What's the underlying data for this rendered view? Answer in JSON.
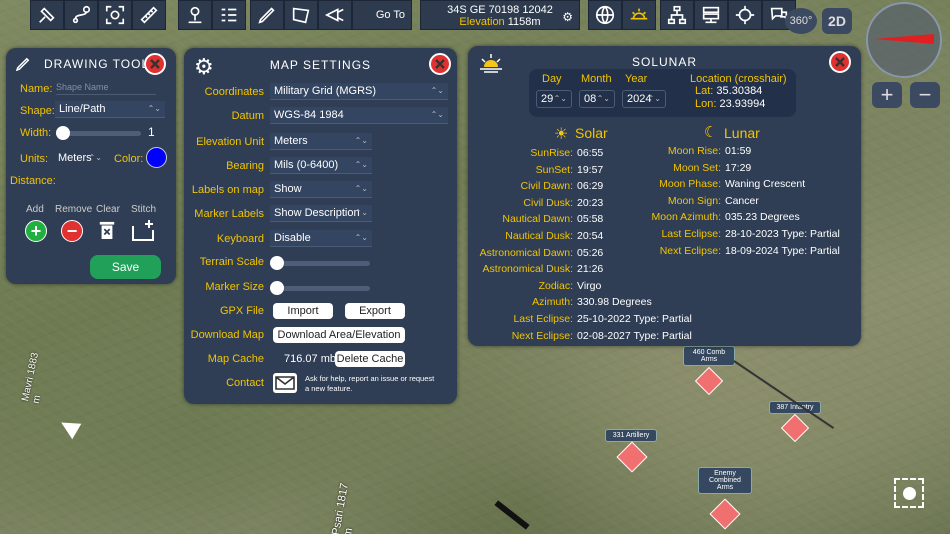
{
  "toolbar": {
    "goto_label": "Go To",
    "coord": "34S GE 70198 12042",
    "elevation_label": "Elevation",
    "elevation_value": "1158m",
    "icons_left": [
      "satellite-icon",
      "route-icon",
      "target-scan-icon",
      "ruler-icon"
    ],
    "icons_mid": [
      "pin-user-icon",
      "list-icon",
      "pencil-icon",
      "polygon-icon",
      "projector-icon"
    ],
    "icons_right": [
      "globe-icon",
      "sunset-icon",
      "network-icon",
      "server-icon",
      "crosshair-icon",
      "chat-icon"
    ]
  },
  "view_modes": {
    "a360": "360°",
    "a2d": "2D"
  },
  "drawing_tool": {
    "title": "DRAWING TOOL",
    "name_label": "Name:",
    "name_placeholder": "Shape Name",
    "shape_label": "Shape:",
    "shape_value": "Line/Path",
    "width_label": "Width:",
    "width_value": "1",
    "units_label": "Units:",
    "units_value": "Meters",
    "color_label": "Color:",
    "color_value": "#0000ff",
    "distance_label": "Distance:",
    "add_label": "Add",
    "remove_label": "Remove",
    "clear_label": "Clear",
    "stitch_label": "Stitch",
    "save_label": "Save"
  },
  "map_settings": {
    "title": "MAP SETTINGS",
    "coordinates_label": "Coordinates",
    "coordinates_value": "Military Grid (MGRS)",
    "datum_label": "Datum",
    "datum_value": "WGS-84 1984",
    "elev_unit_label": "Elevation Unit",
    "elev_unit_value": "Meters",
    "bearing_label": "Bearing",
    "bearing_value": "Mils (0-6400)",
    "labels_label": "Labels on map",
    "labels_value": "Show",
    "marker_labels_label": "Marker Labels",
    "marker_labels_value": "Show Description",
    "keyboard_label": "Keyboard",
    "keyboard_value": "Disable",
    "terrain_label": "Terrain Scale",
    "marker_size_label": "Marker Size",
    "gpx_label": "GPX File",
    "import_label": "Import",
    "export_label": "Export",
    "download_label": "Download Map",
    "download_btn": "Download Area/Elevation",
    "cache_label": "Map Cache",
    "cache_value": "716.07 mb",
    "delete_cache": "Delete Cache",
    "contact_label": "Contact",
    "contact_text": "Ask for help, report an issue or request a new feature."
  },
  "solunar": {
    "title": "SOLUNAR",
    "day_label": "Day",
    "day_value": "29",
    "month_label": "Month",
    "month_value": "08",
    "year_label": "Year",
    "year_value": "2024",
    "location_label": "Location (crosshair)",
    "lat_label": "Lat:",
    "lat_value": "35.30384",
    "lon_label": "Lon:",
    "lon_value": "23.93994",
    "solar_title": "Solar",
    "lunar_title": "Lunar",
    "solar_rows": [
      {
        "k": "SunRise:",
        "v": "06:55"
      },
      {
        "k": "SunSet:",
        "v": "19:57"
      },
      {
        "k": "Civil Dawn:",
        "v": "06:29"
      },
      {
        "k": "Civil Dusk:",
        "v": "20:23"
      },
      {
        "k": "Nautical Dawn:",
        "v": "05:58"
      },
      {
        "k": "Nautical Dusk:",
        "v": "20:54"
      },
      {
        "k": "Astronomical Dawn:",
        "v": "05:26"
      },
      {
        "k": "Astronomical Dusk:",
        "v": "21:26"
      },
      {
        "k": "Zodiac:",
        "v": "Virgo"
      },
      {
        "k": "Azimuth:",
        "v": "330.98 Degrees"
      },
      {
        "k": "Last Eclipse:",
        "v": "25-10-2022 Type: Partial"
      },
      {
        "k": "Next Eclipse:",
        "v": "02-08-2027 Type: Partial"
      }
    ],
    "lunar_rows": [
      {
        "k": "Moon Rise:",
        "v": "01:59"
      },
      {
        "k": "Moon Set:",
        "v": "17:29"
      },
      {
        "k": "Moon Phase:",
        "v": "Waning Crescent"
      },
      {
        "k": "Moon Sign:",
        "v": "Cancer"
      },
      {
        "k": "Moon Azimuth:",
        "v": "035.23 Degrees"
      },
      {
        "k": "Last Eclipse:",
        "v": "28-10-2023 Type: Partial"
      },
      {
        "k": "Next Eclipse:",
        "v": "18-09-2024 Type: Partial"
      }
    ]
  },
  "map_labels": {
    "u460": "460 Comb Arms",
    "u387": "387 Infantry",
    "u331": "331 Artillery",
    "enemy": "Enemy Combined Arms",
    "peak1": "Mavri 1883 m",
    "peak2": "Psari 1817 m"
  }
}
